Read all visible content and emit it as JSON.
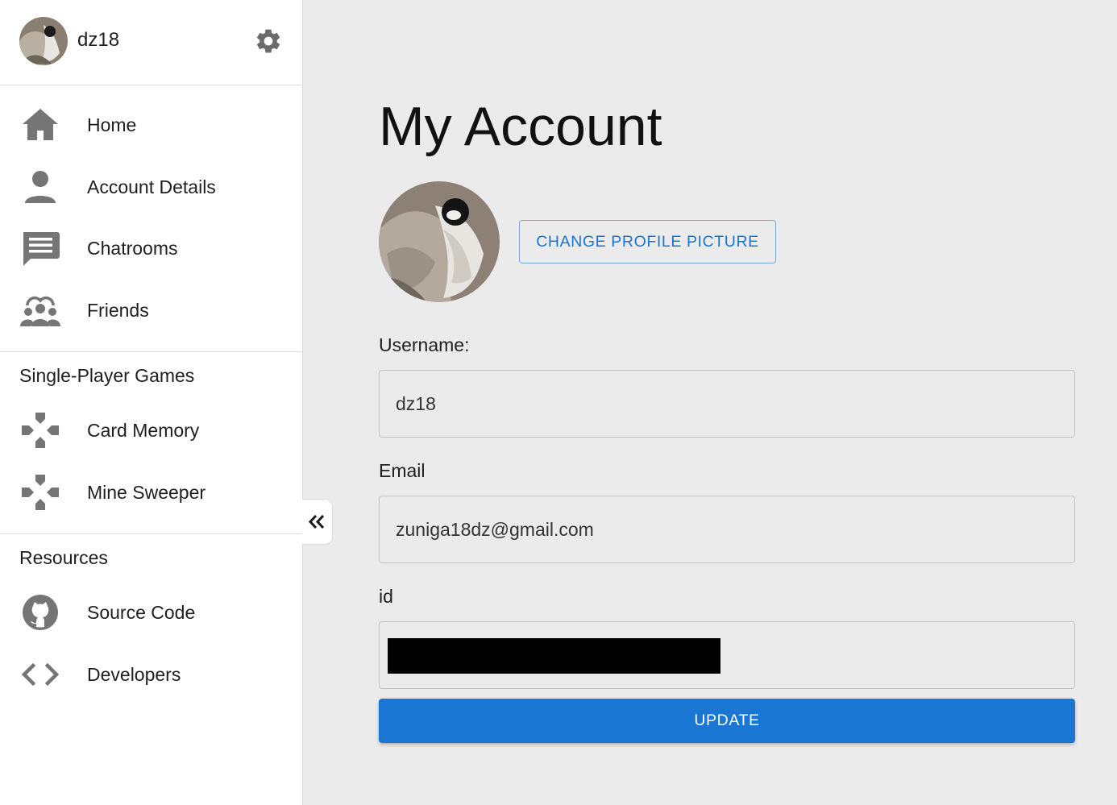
{
  "user": {
    "username": "dz18"
  },
  "sidebar": {
    "main_items": [
      {
        "label": "Home",
        "icon": "home-icon"
      },
      {
        "label": "Account Details",
        "icon": "person-icon"
      },
      {
        "label": "Chatrooms",
        "icon": "chat-icon"
      },
      {
        "label": "Friends",
        "icon": "group-icon"
      }
    ],
    "games_section": {
      "title": "Single-Player Games",
      "items": [
        {
          "label": "Card Memory",
          "icon": "gamepad-icon"
        },
        {
          "label": "Mine Sweeper",
          "icon": "gamepad-icon"
        }
      ]
    },
    "resources_section": {
      "title": "Resources",
      "items": [
        {
          "label": "Source Code",
          "icon": "github-icon"
        },
        {
          "label": "Developers",
          "icon": "code-icon"
        }
      ]
    }
  },
  "main": {
    "title": "My Account",
    "change_picture_label": "CHANGE PROFILE PICTURE",
    "fields": {
      "username": {
        "label": "Username:",
        "value": "dz18"
      },
      "email": {
        "label": "Email",
        "value": "zuniga18dz@gmail.com"
      },
      "id": {
        "label": "id",
        "value": ""
      }
    },
    "update_label": "UPDATE"
  },
  "colors": {
    "accent": "#1976d2",
    "background": "#ebebeb",
    "sidebar_bg": "#ffffff",
    "icon_gray": "#757575"
  }
}
